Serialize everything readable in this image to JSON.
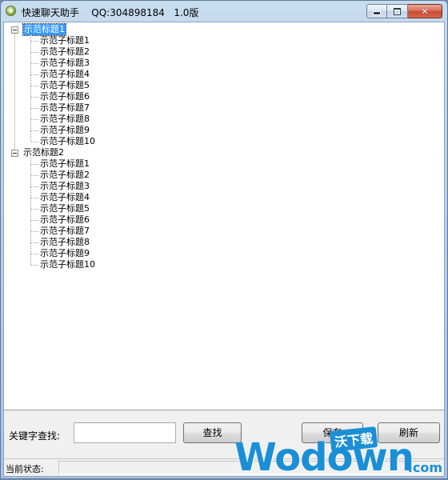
{
  "window": {
    "title": "快速聊天助手    QQ:304898184   1.0版",
    "icon": "app-icon",
    "controls": {
      "minimize": "minimize-icon",
      "maximize": "maximize-icon",
      "close": "close-icon"
    }
  },
  "tree": {
    "groups": [
      {
        "label": "示范标题1",
        "selected": true,
        "children": [
          "示范子标题1",
          "示范子标题2",
          "示范子标题3",
          "示范子标题4",
          "示范子标题5",
          "示范子标题6",
          "示范子标题7",
          "示范子标题8",
          "示范子标题9",
          "示范子标题10"
        ]
      },
      {
        "label": "示范标题2",
        "selected": false,
        "children": [
          "示范子标题1",
          "示范子标题2",
          "示范子标题3",
          "示范子标题4",
          "示范子标题5",
          "示范子标题6",
          "示范子标题7",
          "示范子标题8",
          "示范子标题9",
          "示范子标题10"
        ]
      }
    ]
  },
  "search": {
    "label": "关键字查找:",
    "value": "",
    "button": "查找"
  },
  "actions": {
    "save": "保存",
    "refresh": "刷新"
  },
  "status": {
    "label": "当前状态:",
    "value": ""
  },
  "watermark": {
    "text": "Wodown",
    "domain": ".com",
    "badge": "沃下载"
  }
}
